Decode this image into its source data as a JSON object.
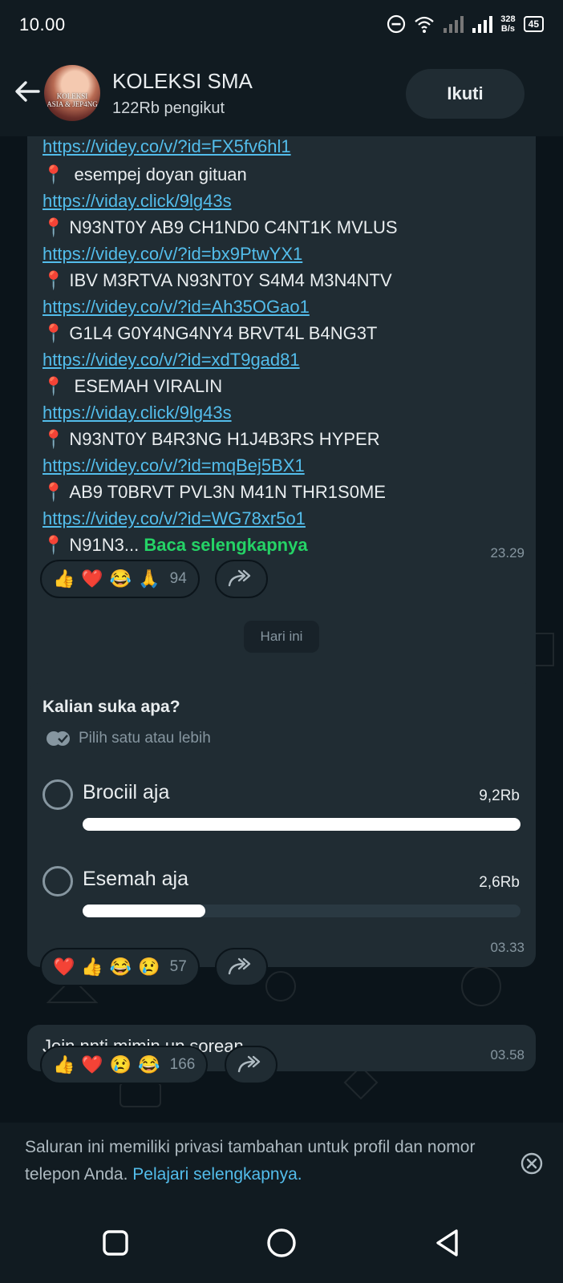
{
  "status_bar": {
    "time": "10.00",
    "net_speed_value": "328",
    "net_speed_unit": "B/s",
    "battery": "45"
  },
  "header": {
    "channel_name": "KOLEKSI SMA",
    "followers": "122Rb pengikut",
    "follow_label": "Ikuti",
    "avatar_text_line1": "KOLEKSI",
    "avatar_text_line2": "ASIA & JEP4NG"
  },
  "message1": {
    "lines": [
      {
        "type": "link",
        "text": "https://videy.co/v/?id=FX5fv6hl1"
      },
      {
        "type": "text",
        "text": " esempej doyan gituan"
      },
      {
        "type": "link",
        "text": "https://viday.click/9lg43s"
      },
      {
        "type": "text",
        "text": "N93NT0Y AB9 CH1ND0 C4NT1K MVLUS"
      },
      {
        "type": "link",
        "text": "https://videy.co/v/?id=bx9PtwYX1"
      },
      {
        "type": "text",
        "text": "IBV M3RTVA N93NT0Y S4M4 M3N4NTV"
      },
      {
        "type": "link",
        "text": "https://videy.co/v/?id=Ah35OGao1"
      },
      {
        "type": "text",
        "text": "G1L4 G0Y4NG4NY4 BRVT4L B4NG3T"
      },
      {
        "type": "link",
        "text": "https://videy.co/v/?id=xdT9gad81"
      },
      {
        "type": "text",
        "text": " ESEMAH VIRALIN"
      },
      {
        "type": "link",
        "text": "https://viday.click/9lg43s"
      },
      {
        "type": "text",
        "text": "N93NT0Y B4R3NG H1J4B3RS HYPER"
      },
      {
        "type": "link",
        "text": "https://videy.co/v/?id=mqBej5BX1"
      },
      {
        "type": "text",
        "text": "AB9 T0BRVT PVL3N M41N THR1S0ME"
      },
      {
        "type": "link",
        "text": "https://videy.co/v/?id=WG78xr5o1"
      }
    ],
    "last_line_text": "N91N3...",
    "read_more": "Baca selengkapnya",
    "time": "23.29",
    "reactions": [
      "👍",
      "❤️",
      "😂",
      "🙏"
    ],
    "reaction_count": "94"
  },
  "date_chip": "Hari ini",
  "poll": {
    "question": "Kalian suka apa?",
    "hint": "Pilih satu atau lebih",
    "options": [
      {
        "label": "Brociil aja",
        "count": "9,2Rb",
        "share": 1.0
      },
      {
        "label": "Esemah aja",
        "count": "2,6Rb",
        "share": 0.28
      }
    ],
    "time": "03.33",
    "reactions": [
      "❤️",
      "👍",
      "😂",
      "😢"
    ],
    "reaction_count": "57"
  },
  "message3": {
    "text": "Join nnti mimin up sorean",
    "time": "03.58",
    "reactions": [
      "👍",
      "❤️",
      "😢",
      "😂"
    ],
    "reaction_count": "166"
  },
  "notice": {
    "text": "Saluran ini memiliki privasi tambahan untuk profil dan nomor telepon Anda.",
    "link": "Pelajari selengkapnya."
  },
  "colors": {
    "bubble": "#202c33",
    "link": "#53bdeb",
    "accent_green": "#25d366",
    "background": "#0b141a"
  },
  "icons": [
    "back-arrow-icon",
    "dnd-icon",
    "wifi-icon",
    "signal-icon",
    "pin-icon",
    "forward-icon",
    "double-check-icon",
    "close-circle-icon",
    "recents-nav-icon",
    "home-nav-icon",
    "back-nav-icon"
  ]
}
